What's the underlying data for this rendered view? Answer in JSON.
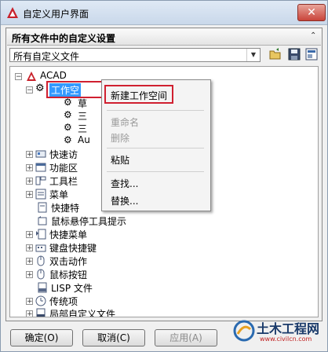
{
  "window": {
    "title": "自定义用户界面",
    "close_glyph": "✕"
  },
  "section": {
    "title": "所有文件中的自定义设置",
    "collapse_glyph": "⌃"
  },
  "combo": {
    "value": "所有自定义文件"
  },
  "tree": {
    "root": "ACAD",
    "workspaces": "工作空",
    "ws_children": [
      "草",
      "三",
      "三",
      "Au"
    ],
    "items": [
      "快速访",
      "功能区",
      "工具栏",
      "菜单",
      "快捷特",
      "鼠标悬停工具提示",
      "快捷菜单",
      "键盘快捷键",
      "双击动作",
      "鼠标按钮",
      "LISP 文件",
      "传统项",
      "局部自定义文件"
    ]
  },
  "context_menu": {
    "new_workspace": "新建工作空间",
    "rename": "重命名",
    "delete": "删除",
    "paste": "粘贴",
    "find": "查找...",
    "replace": "替换..."
  },
  "buttons": {
    "ok": "确定(O)",
    "cancel": "取消(C)",
    "apply": "应用(A)"
  },
  "watermark": {
    "brand": "土木工程网",
    "url": "www.civilcn.com"
  },
  "colors": {
    "selection": "#3399ff",
    "highlight_box": "#d02030",
    "acad_red": "#c8202a"
  }
}
